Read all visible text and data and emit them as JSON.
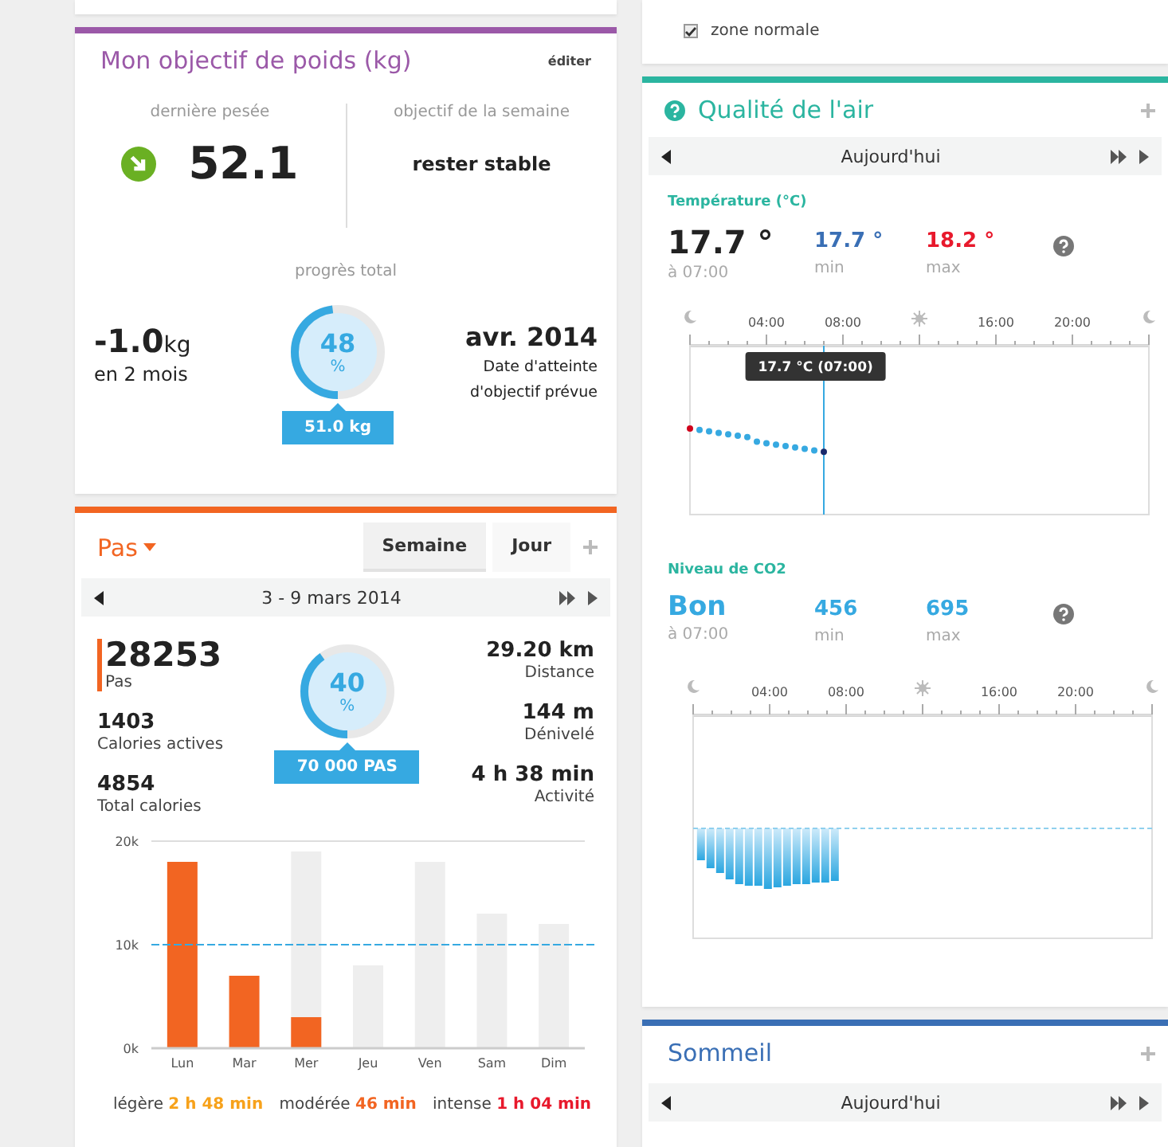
{
  "weight_card": {
    "title": "Mon objectif de poids (kg)",
    "edit_link": "éditer",
    "last_weighing": {
      "label": "dernière pesée",
      "value": "52.1"
    },
    "weekly_goal": {
      "label": "objectif de la semaine",
      "value": "rester stable"
    },
    "total_progress": {
      "label": "progrès total",
      "change": "-1.0",
      "unit": "kg",
      "period": "en 2 mois",
      "ring": {
        "value": "48",
        "unit": "%",
        "level": 0.48
      },
      "target": "51.0 kg",
      "date": "avr. 2014",
      "date_caption": "Date d'atteinte d'objectif prévue"
    }
  },
  "steps_card": {
    "title": "Pas",
    "tabs": [
      {
        "label": "Semaine",
        "selected": true
      },
      {
        "label": "Jour",
        "selected": false
      }
    ],
    "period": "3 - 9 mars 2014",
    "main_stat": {
      "value": "28253",
      "label": "Pas"
    },
    "left_stats": [
      {
        "value": "1403",
        "label": "Calories actives"
      },
      {
        "value": "4854",
        "label": "Total calories"
      }
    ],
    "right_stats": [
      {
        "value": "29.20 km",
        "label": "Distance"
      },
      {
        "value": "144 m",
        "label": "Dénivelé"
      },
      {
        "value": "4 h 38 min",
        "label": "Activité"
      }
    ],
    "ring": {
      "value": "40",
      "unit": "%",
      "level": 0.4
    },
    "goal": "70 000 PAS",
    "chart_data": {
      "type": "bar",
      "categories": [
        "Lun",
        "Mar",
        "Mer",
        "Jeu",
        "Ven",
        "Sam",
        "Dim"
      ],
      "ylim": [
        0,
        20000
      ],
      "yticks": [
        {
          "value": 0,
          "label": "0k"
        },
        {
          "value": 10000,
          "label": "10k"
        },
        {
          "value": 20000,
          "label": "20k"
        }
      ],
      "stacked": false,
      "ref_lines": [
        {
          "axis": "y",
          "value": 10000,
          "color": "#36a9e1"
        }
      ],
      "series": [
        {
          "color": "#eeeeee",
          "values": [
            null,
            null,
            19000,
            8000,
            18000,
            13000,
            12000
          ]
        },
        {
          "color": "#f26522",
          "values": [
            18000,
            7000,
            3000,
            null,
            null,
            null,
            null
          ]
        }
      ]
    },
    "intensity": [
      {
        "label": "légère",
        "value": "2 h 48 min",
        "color": "#f7a21b"
      },
      {
        "label": "modérée",
        "value": "46 min",
        "color": "#f26522"
      },
      {
        "label": "intense",
        "value": "1 h 04 min",
        "color": "#e8192c"
      }
    ]
  },
  "zone_option": {
    "label": "zone normale",
    "checked": true
  },
  "air_card": {
    "title": "Qualité de l'air",
    "period": "Aujourd'hui",
    "temperature": {
      "title": "Température (°C)",
      "current": "17.7 °",
      "time": "à 07:00",
      "min": "17.7 °",
      "min_label": "min",
      "max": "18.2 °",
      "max_label": "max",
      "ticks": [
        "04:00",
        "08:00",
        "16:00",
        "20:00"
      ],
      "tooltip": "17.7 °C (07:00)"
    },
    "co2": {
      "title": "Niveau de CO2",
      "current": "Bon",
      "time": "à 07:00",
      "min": "456",
      "min_label": "min",
      "max": "695",
      "max_label": "max",
      "ticks": [
        "04:00",
        "08:00",
        "16:00",
        "20:00"
      ]
    }
  },
  "sleep_card": {
    "title": "Sommeil",
    "period": "Aujourd'hui"
  }
}
